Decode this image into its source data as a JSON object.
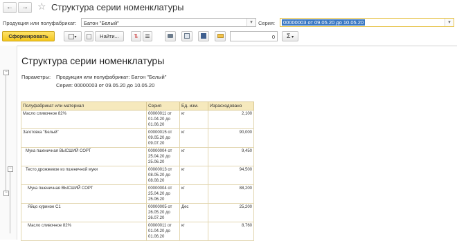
{
  "window": {
    "title": "Структура серии номенклатуры"
  },
  "filters": {
    "product_label": "Продукция или полуфабрикат:",
    "product_value": "Батон \"Белый\"",
    "series_label": "Серия:",
    "series_value": "00000003 от 09.05.20 до 10.05.20"
  },
  "toolbar": {
    "generate_label": "Сформировать",
    "find_label": "Найти...",
    "number_value": "0",
    "sigma": "Σ"
  },
  "report": {
    "title": "Структура серии номенклатуры",
    "params_label": "Параметры:",
    "params_product": "Продукция или полуфабрикат: Батон \"Белый\"",
    "params_series": "Серия: 00000003 от 09.05.20 до 10.05.20",
    "columns": [
      "Полуфабрикат или материал",
      "Серия",
      "Ед. изм.",
      "Израсходовано"
    ],
    "rows": [
      {
        "level": 1,
        "name": "Масло сливочное 82%",
        "series": [
          "00000011 от",
          "01.04.20 до",
          "01.06.20"
        ],
        "unit": "кг",
        "amount": "2,100"
      },
      {
        "level": 1,
        "name": "Заготовка \"Белый\"",
        "series": [
          "00000015 от",
          "09.05.20 до",
          "09.07.20"
        ],
        "unit": "кг",
        "amount": "90,000"
      },
      {
        "level": 2,
        "name": "Мука пшеничная ВЫСШИЙ СОРТ",
        "series": [
          "00000004 от",
          "25.04.20 до",
          "25.06.20"
        ],
        "unit": "кг",
        "amount": "9,450"
      },
      {
        "level": 2,
        "name": "Тесто дрожжевое из пшеничной муки",
        "series": [
          "00000013 от",
          "08.05.20 до",
          "08.08.20"
        ],
        "unit": "кг",
        "amount": "94,500"
      },
      {
        "level": 3,
        "name": "Мука пшеничная ВЫСШИЙ СОРТ",
        "series": [
          "00000004 от",
          "25.04.20 до",
          "25.06.20"
        ],
        "unit": "кг",
        "amount": "88,200"
      },
      {
        "level": 3,
        "name": "Яйцо куриное С1",
        "series": [
          "00000005 от",
          "26.05.20 до",
          "26.07.20"
        ],
        "unit": "Дес",
        "amount": "25,200"
      },
      {
        "level": 3,
        "name": "Масло сливочное 82%",
        "series": [
          "00000011 от",
          "01.04.20 до",
          "01.06.20"
        ],
        "unit": "кг",
        "amount": "8,760"
      }
    ]
  }
}
